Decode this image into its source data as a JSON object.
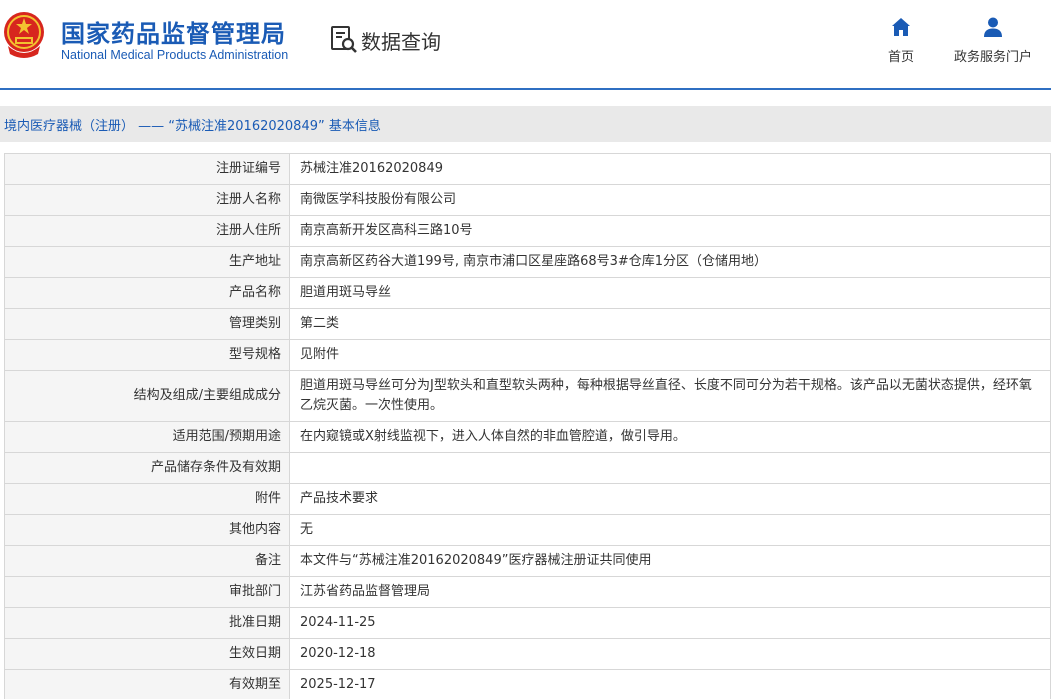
{
  "header": {
    "logo_cn": "国家药品监督管理局",
    "logo_en": "National Medical Products Administration",
    "query_label": "数据查询",
    "nav": [
      {
        "label": "首页",
        "icon": "home-icon"
      },
      {
        "label": "政务服务门户",
        "icon": "user-icon"
      }
    ]
  },
  "colors": {
    "brand": "#1a5bb5",
    "header_line": "#2f6fc2",
    "label_bg": "#f5f5f5",
    "title_bg": "#e9e9e9"
  },
  "title": "境内医疗器械（注册） —— “苏械注准20162020849” 基本信息",
  "rows": [
    {
      "key": "注册证编号",
      "value": "苏械注准20162020849"
    },
    {
      "key": "注册人名称",
      "value": "南微医学科技股份有限公司"
    },
    {
      "key": "注册人住所",
      "value": "南京高新开发区高科三路10号"
    },
    {
      "key": "生产地址",
      "value": "南京高新区药谷大道199号, 南京市浦口区星座路68号3#仓库1分区（仓储用地）"
    },
    {
      "key": "产品名称",
      "value": "胆道用斑马导丝"
    },
    {
      "key": "管理类别",
      "value": "第二类"
    },
    {
      "key": "型号规格",
      "value": "见附件"
    },
    {
      "key": "结构及组成/主要组成成分",
      "value": "胆道用斑马导丝可分为J型软头和直型软头两种，每种根据导丝直径、长度不同可分为若干规格。该产品以无菌状态提供，经环氧乙烷灭菌。一次性使用。"
    },
    {
      "key": "适用范围/预期用途",
      "value": "在内窥镜或X射线监视下，进入人体自然的非血管腔道，做引导用。"
    },
    {
      "key": "产品储存条件及有效期",
      "value": ""
    },
    {
      "key": "附件",
      "value": "产品技术要求"
    },
    {
      "key": "其他内容",
      "value": "无"
    },
    {
      "key": "备注",
      "value": "本文件与“苏械注准20162020849”医疗器械注册证共同使用"
    },
    {
      "key": "审批部门",
      "value": "江苏省药品监督管理局"
    },
    {
      "key": "批准日期",
      "value": "2024-11-25"
    },
    {
      "key": "生效日期",
      "value": "2020-12-18"
    },
    {
      "key": "有效期至",
      "value": "2025-12-17"
    }
  ]
}
